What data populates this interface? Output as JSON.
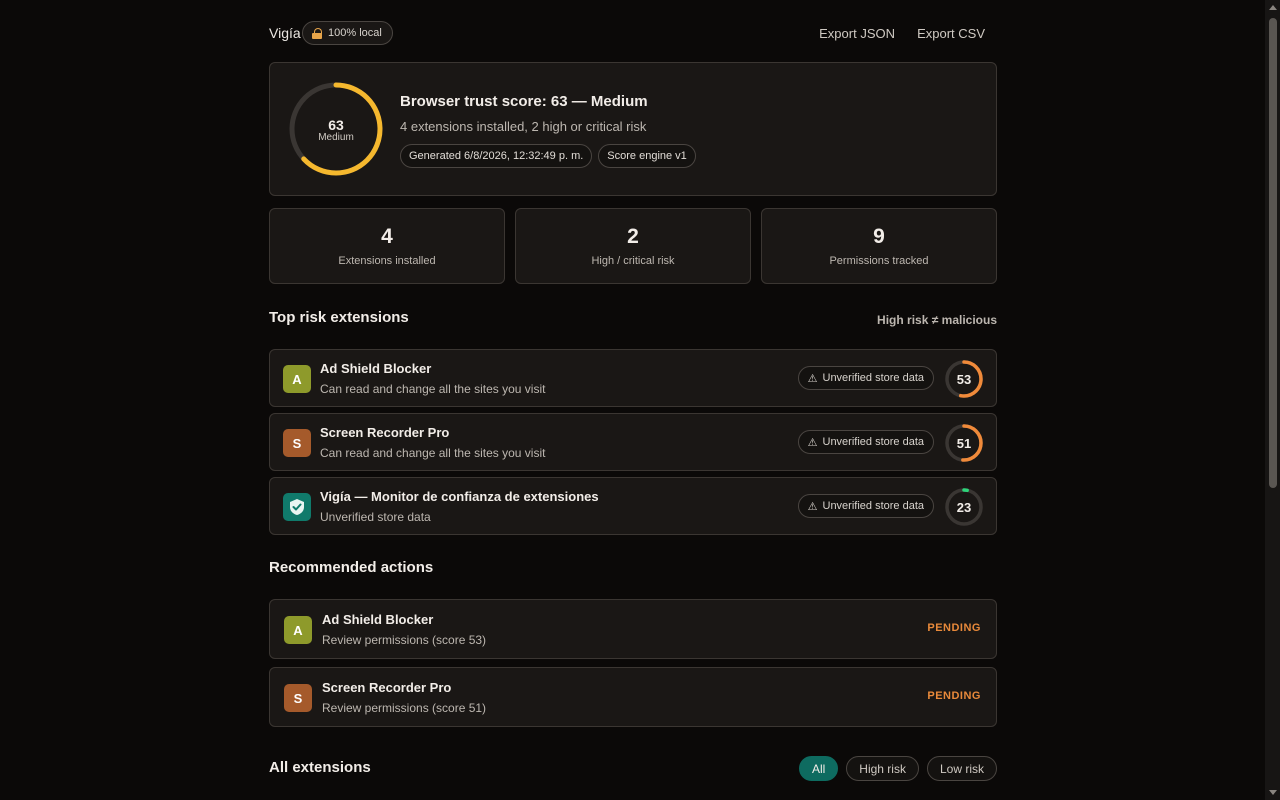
{
  "header": {
    "brand": "Vigía",
    "local_badge": "100% local",
    "export_json": "Export JSON",
    "export_csv": "Export CSV"
  },
  "summary": {
    "score": 63,
    "score_label": "Medium",
    "score_max": 100,
    "title": "Browser trust score: 63 — Medium",
    "subtitle": "4 extensions installed, 2 high or critical risk",
    "generated": "Generated 6/8/2026, 12:32:49 p. m.",
    "engine": "Score engine v1",
    "gauge_color": "#f5b82e"
  },
  "stats": [
    {
      "value": "4",
      "label": "Extensions installed"
    },
    {
      "value": "2",
      "label": "High / critical risk"
    },
    {
      "value": "9",
      "label": "Permissions tracked"
    }
  ],
  "top_risk": {
    "title": "Top risk extensions",
    "note": "High risk ≠ malicious",
    "items": [
      {
        "initial": "A",
        "name": "Ad Shield Blocker",
        "desc": "Can read and change all the sites you visit",
        "badge": "Unverified store data",
        "score": "53",
        "score_value": 53,
        "color": "#f08a3a"
      },
      {
        "initial": "S",
        "name": "Screen Recorder Pro",
        "desc": "Can read and change all the sites you visit",
        "badge": "Unverified store data",
        "score": "51",
        "score_value": 51,
        "color": "#f08a3a"
      },
      {
        "initial": "shield-check-icon",
        "name": "Vigía — Monitor de confianza de extensiones",
        "desc": "Unverified store data",
        "badge": "Unverified store data",
        "score": "23",
        "score_value": 23,
        "color": "#2ed47a"
      }
    ]
  },
  "actions": {
    "title": "Recommended actions",
    "items": [
      {
        "initial": "A",
        "name": "Ad Shield Blocker",
        "desc": "Review permissions (score 53)",
        "status": "PENDING"
      },
      {
        "initial": "S",
        "name": "Screen Recorder Pro",
        "desc": "Review permissions (score 51)",
        "status": "PENDING"
      }
    ]
  },
  "all_extensions": {
    "title": "All extensions",
    "filters": [
      "All",
      "High risk",
      "Low risk"
    ],
    "active_filter": "All"
  }
}
